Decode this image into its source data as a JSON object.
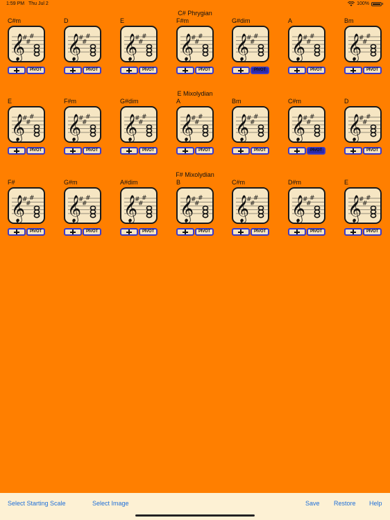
{
  "status": {
    "time": "1:59 PM",
    "date": "Thu Jul 2",
    "battery": "100%"
  },
  "sections": [
    {
      "title": "C# Phrygian",
      "chords": [
        {
          "name": "C#m",
          "active_pivot": false
        },
        {
          "name": "D",
          "active_pivot": false
        },
        {
          "name": "E",
          "active_pivot": false
        },
        {
          "name": "F#m",
          "active_pivot": false
        },
        {
          "name": "G#dim",
          "active_pivot": true
        },
        {
          "name": "A",
          "active_pivot": false
        },
        {
          "name": "Bm",
          "active_pivot": false
        }
      ]
    },
    {
      "title": "E Mixolydian",
      "chords": [
        {
          "name": "E",
          "active_pivot": false
        },
        {
          "name": "F#m",
          "active_pivot": false
        },
        {
          "name": "G#dim",
          "active_pivot": false
        },
        {
          "name": "A",
          "active_pivot": false
        },
        {
          "name": "Bm",
          "active_pivot": false
        },
        {
          "name": "C#m",
          "active_pivot": true
        },
        {
          "name": "D",
          "active_pivot": false
        }
      ]
    },
    {
      "title": "F# Mixolydian",
      "chords": [
        {
          "name": "F#",
          "active_pivot": false
        },
        {
          "name": "G#m",
          "active_pivot": false
        },
        {
          "name": "A#dim",
          "active_pivot": false
        },
        {
          "name": "B",
          "active_pivot": false
        },
        {
          "name": "C#m",
          "active_pivot": false
        },
        {
          "name": "D#m",
          "active_pivot": false
        },
        {
          "name": "E",
          "active_pivot": false
        }
      ]
    }
  ],
  "pivot_label": "PIVOT",
  "toolbar": {
    "select_scale": "Select Starting Scale",
    "select_image": "Select Image",
    "save": "Save",
    "restore": "Restore",
    "help": "Help"
  },
  "colors": {
    "background": "#ff7f00",
    "card": "#f6e6c3",
    "button_border": "#3a3acb",
    "link": "#1e6fd9"
  }
}
